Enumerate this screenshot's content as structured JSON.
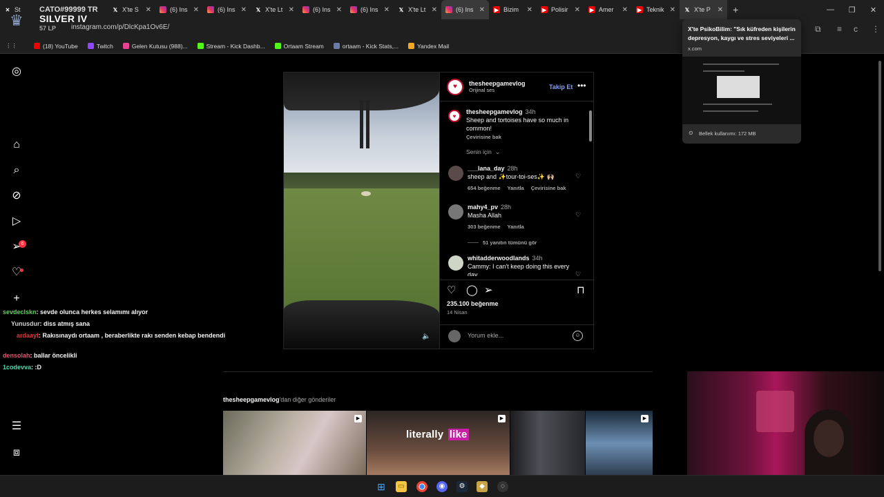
{
  "overlay": {
    "player_tag": "CATO#99999 TR",
    "rank": "SILVER IV",
    "lp": "57 LP"
  },
  "browser": {
    "tabs": [
      {
        "icon": "x",
        "label": "St"
      },
      {
        "icon": "x-logo",
        "label": "X'te S"
      },
      {
        "icon": "instagram",
        "label": "(6) Ins"
      },
      {
        "icon": "instagram",
        "label": "(6) Ins"
      },
      {
        "icon": "x-logo",
        "label": "X'te Lt"
      },
      {
        "icon": "instagram",
        "label": "(6) Ins"
      },
      {
        "icon": "instagram",
        "label": "(6) Ins"
      },
      {
        "icon": "x-logo",
        "label": "X'te Lt"
      },
      {
        "icon": "instagram",
        "label": "(6) Ins"
      },
      {
        "icon": "youtube",
        "label": "Bizim"
      },
      {
        "icon": "youtube",
        "label": "Polisir"
      },
      {
        "icon": "youtube",
        "label": "Amer"
      },
      {
        "icon": "youtube",
        "label": "Teknik"
      },
      {
        "icon": "x-logo",
        "label": "X'te P"
      }
    ],
    "url": "instagram.com/p/DlcKpa1Ov6E/",
    "bookmarks": [
      "(18) YouTube",
      "Twitch",
      "Gelen Kutusu (988)...",
      "Stream - Kick Dashb...",
      "Ortaam Stream",
      "ortaam - Kick Stats,...",
      "Yandex Mail"
    ]
  },
  "tooltip": {
    "title": "X'te PsikoBilim: \"Sık küfreden kişilerin depresyon, kaygı ve stres seviyeleri ...",
    "domain": "x.com",
    "memory": "Bellek kullanımı: 172 MB"
  },
  "post": {
    "username": "thesheepgamevlog",
    "audio": "Orijinal ses",
    "follow_label": "Takip Et",
    "caption_user": "thesheepgamevlog",
    "caption_time": "34h",
    "caption_text": "Sheep and tortoises have so much in common!",
    "caption_translate": "Çevirisine bak",
    "sort_label": "Senin için",
    "comments": [
      {
        "user": "___lana_day",
        "time": "28h",
        "text": "sheep and ✨tour-toi-ses✨ 🙌🏼",
        "likes": "654 beğenme",
        "reply": "Yanıtla",
        "translate": "Çevirisine bak"
      },
      {
        "user": "mahy4_pv",
        "time": "28h",
        "text": "Masha Allah",
        "likes": "303 beğenme",
        "reply": "Yanıtla"
      },
      {
        "user": "whitadderwoodlands",
        "time": "34h",
        "text": "Cammy: I can't keep doing this every day"
      }
    ],
    "view_replies": "51 yanıtın tümünü gör",
    "like_count": "235.100 beğenme",
    "date": "14 Nisan",
    "comment_placeholder": "Yorum ekle..."
  },
  "more_posts": {
    "user": "thesheepgamevlog",
    "suffix": "'dan diğer gönderiler",
    "thumb2_text_a": "literally",
    "thumb2_text_b": "like"
  },
  "chat": [
    {
      "user": "sevdeclskn",
      "color": "#5fd35f",
      "text": ": sevde olunca herkes selamımı alıyor"
    },
    {
      "user": "Yunusdur",
      "color": "#cfcfcf",
      "text": ": diss atmış sana"
    },
    {
      "user": "ardaayt",
      "color": "#e03a3a",
      "text": ": Rakısınaydı ortaam , beraberlikte rakı senden kebap bendendi"
    },
    {
      "user": "densolah",
      "color": "#e0556e",
      "text": ": ballar öncelikli"
    },
    {
      "user": "1codevva",
      "color": "#4ed8b0",
      "text": ": :D"
    }
  ],
  "colors": {
    "link_blue": "#85a1ff",
    "badge_red": "#ff3040"
  }
}
